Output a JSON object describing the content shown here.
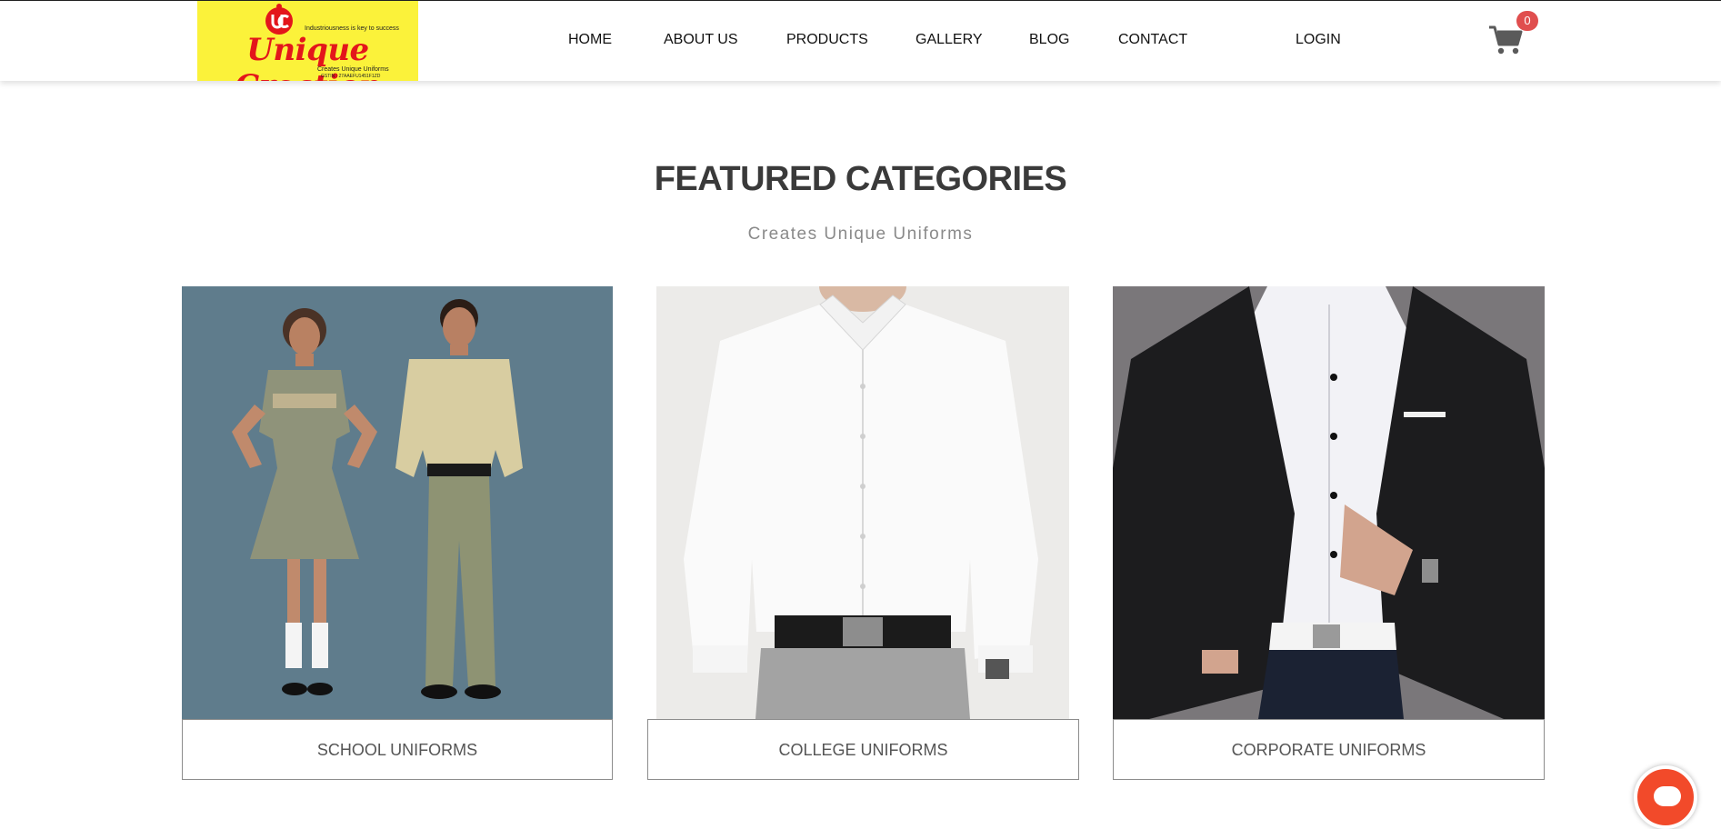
{
  "logo": {
    "tagline": "Industriousness is key to success",
    "brand": "Unique Creation",
    "subtitle": "Creates Unique Uniforms",
    "gstin": "GSTIN : 27AAEFU1451F1ZD"
  },
  "nav": {
    "items": [
      "HOME",
      "ABOUT US",
      "PRODUCTS",
      "GALLERY",
      "BLOG",
      "CONTACT"
    ],
    "login": "LOGIN"
  },
  "cart": {
    "icon": "shopping-cart-icon",
    "count": "0"
  },
  "featured": {
    "title": "FEATURED CATEGORIES",
    "subtitle": "Creates Unique Uniforms",
    "categories": [
      {
        "label": "SCHOOL UNIFORMS"
      },
      {
        "label": "COLLEGE UNIFORMS"
      },
      {
        "label": "CORPORATE UNIFORMS"
      }
    ]
  },
  "chat": {
    "icon": "chat-bubble-icon"
  },
  "colors": {
    "logo_bg": "#fbf23a",
    "brand_red": "#e3161b",
    "badge": "#e04e4e",
    "chat": "#f24a2a"
  }
}
